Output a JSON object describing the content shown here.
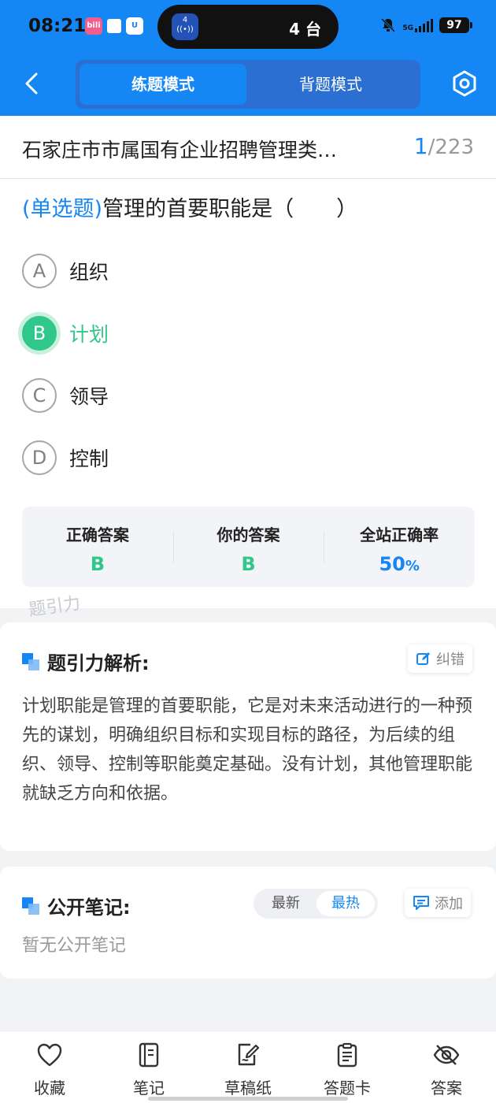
{
  "status_bar": {
    "time": "08:21",
    "island_badge": "4",
    "island_text": "4 台",
    "network": "5G",
    "battery": "97"
  },
  "nav": {
    "mode_tabs": [
      {
        "label": "练题模式",
        "active": true
      },
      {
        "label": "背题模式",
        "active": false
      }
    ]
  },
  "question_card": {
    "paper_title": "石家庄市市属国有企业招聘管理类…",
    "counter_current": "1",
    "counter_sep": "/",
    "counter_total": "223",
    "question_type": "(单选题)",
    "question_text": "管理的首要职能是（　　）",
    "options": [
      {
        "letter": "A",
        "text": "组织"
      },
      {
        "letter": "B",
        "text": "计划",
        "state": "correct"
      },
      {
        "letter": "C",
        "text": "领导"
      },
      {
        "letter": "D",
        "text": "控制"
      }
    ],
    "answer_summary": {
      "correct_label": "正确答案",
      "correct_value": "B",
      "yours_label": "你的答案",
      "yours_value": "B",
      "rate_label": "全站正确率",
      "rate_value": "50",
      "rate_unit": "%"
    },
    "watermark": "题引力"
  },
  "analysis": {
    "title": "题引力解析:",
    "report_button": "纠错",
    "text": "计划职能是管理的首要职能，它是对未来活动进行的一种预先的谋划，明确组织目标和实现目标的路径，为后续的组织、领导、控制等职能奠定基础。没有计划，其他管理职能就缺乏方向和依据。"
  },
  "notes": {
    "title": "公开笔记:",
    "sort_latest": "最新",
    "sort_hot": "最热",
    "add_button": "添加",
    "empty_text": "暂无公开笔记"
  },
  "bottom_tabs": [
    {
      "label": "收藏",
      "icon": "heart-icon"
    },
    {
      "label": "笔记",
      "icon": "notebook-icon"
    },
    {
      "label": "草稿纸",
      "icon": "draft-paper-icon"
    },
    {
      "label": "答题卡",
      "icon": "answer-card-icon"
    },
    {
      "label": "答案",
      "icon": "eye-off-icon"
    }
  ],
  "colors": {
    "primary": "#1487f5",
    "correct": "#2fc78a"
  }
}
